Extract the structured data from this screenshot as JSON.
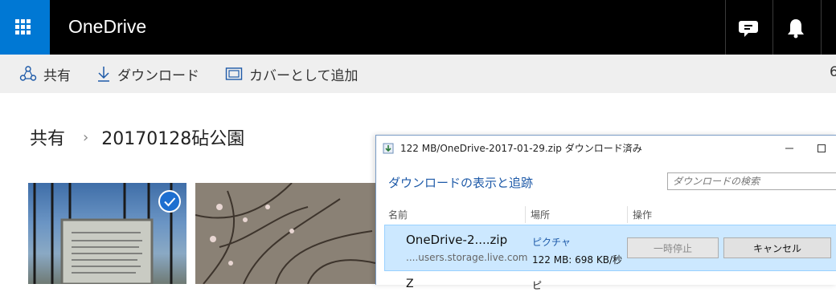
{
  "app": {
    "brand": "OneDrive"
  },
  "header": {
    "icons": [
      "chat-icon",
      "bell-icon"
    ],
    "accent": "#0078d4"
  },
  "commandbar": {
    "share_label": "共有",
    "download_label": "ダウンロード",
    "cover_label": "カバーとして追加",
    "overflow_label": "6"
  },
  "breadcrumb": {
    "parent": "共有",
    "current": "20170128砧公園"
  },
  "dialog": {
    "title": "122 MB/OneDrive-2017-01-29.zip ダウンロード済み",
    "heading": "ダウンロードの表示と追跡",
    "search_placeholder": "ダウンロードの検索",
    "columns": {
      "name": "名前",
      "location": "場所",
      "action": "操作"
    },
    "rows": [
      {
        "name": "OneDrive-2....zip",
        "source": "....users.storage.live.com",
        "location": "ピクチャ",
        "progress": "122 MB: 698 KB/秒",
        "pause_label": "一時停止",
        "cancel_label": "キャンセル"
      },
      {
        "name": "Z",
        "location": "ピ"
      }
    ]
  }
}
